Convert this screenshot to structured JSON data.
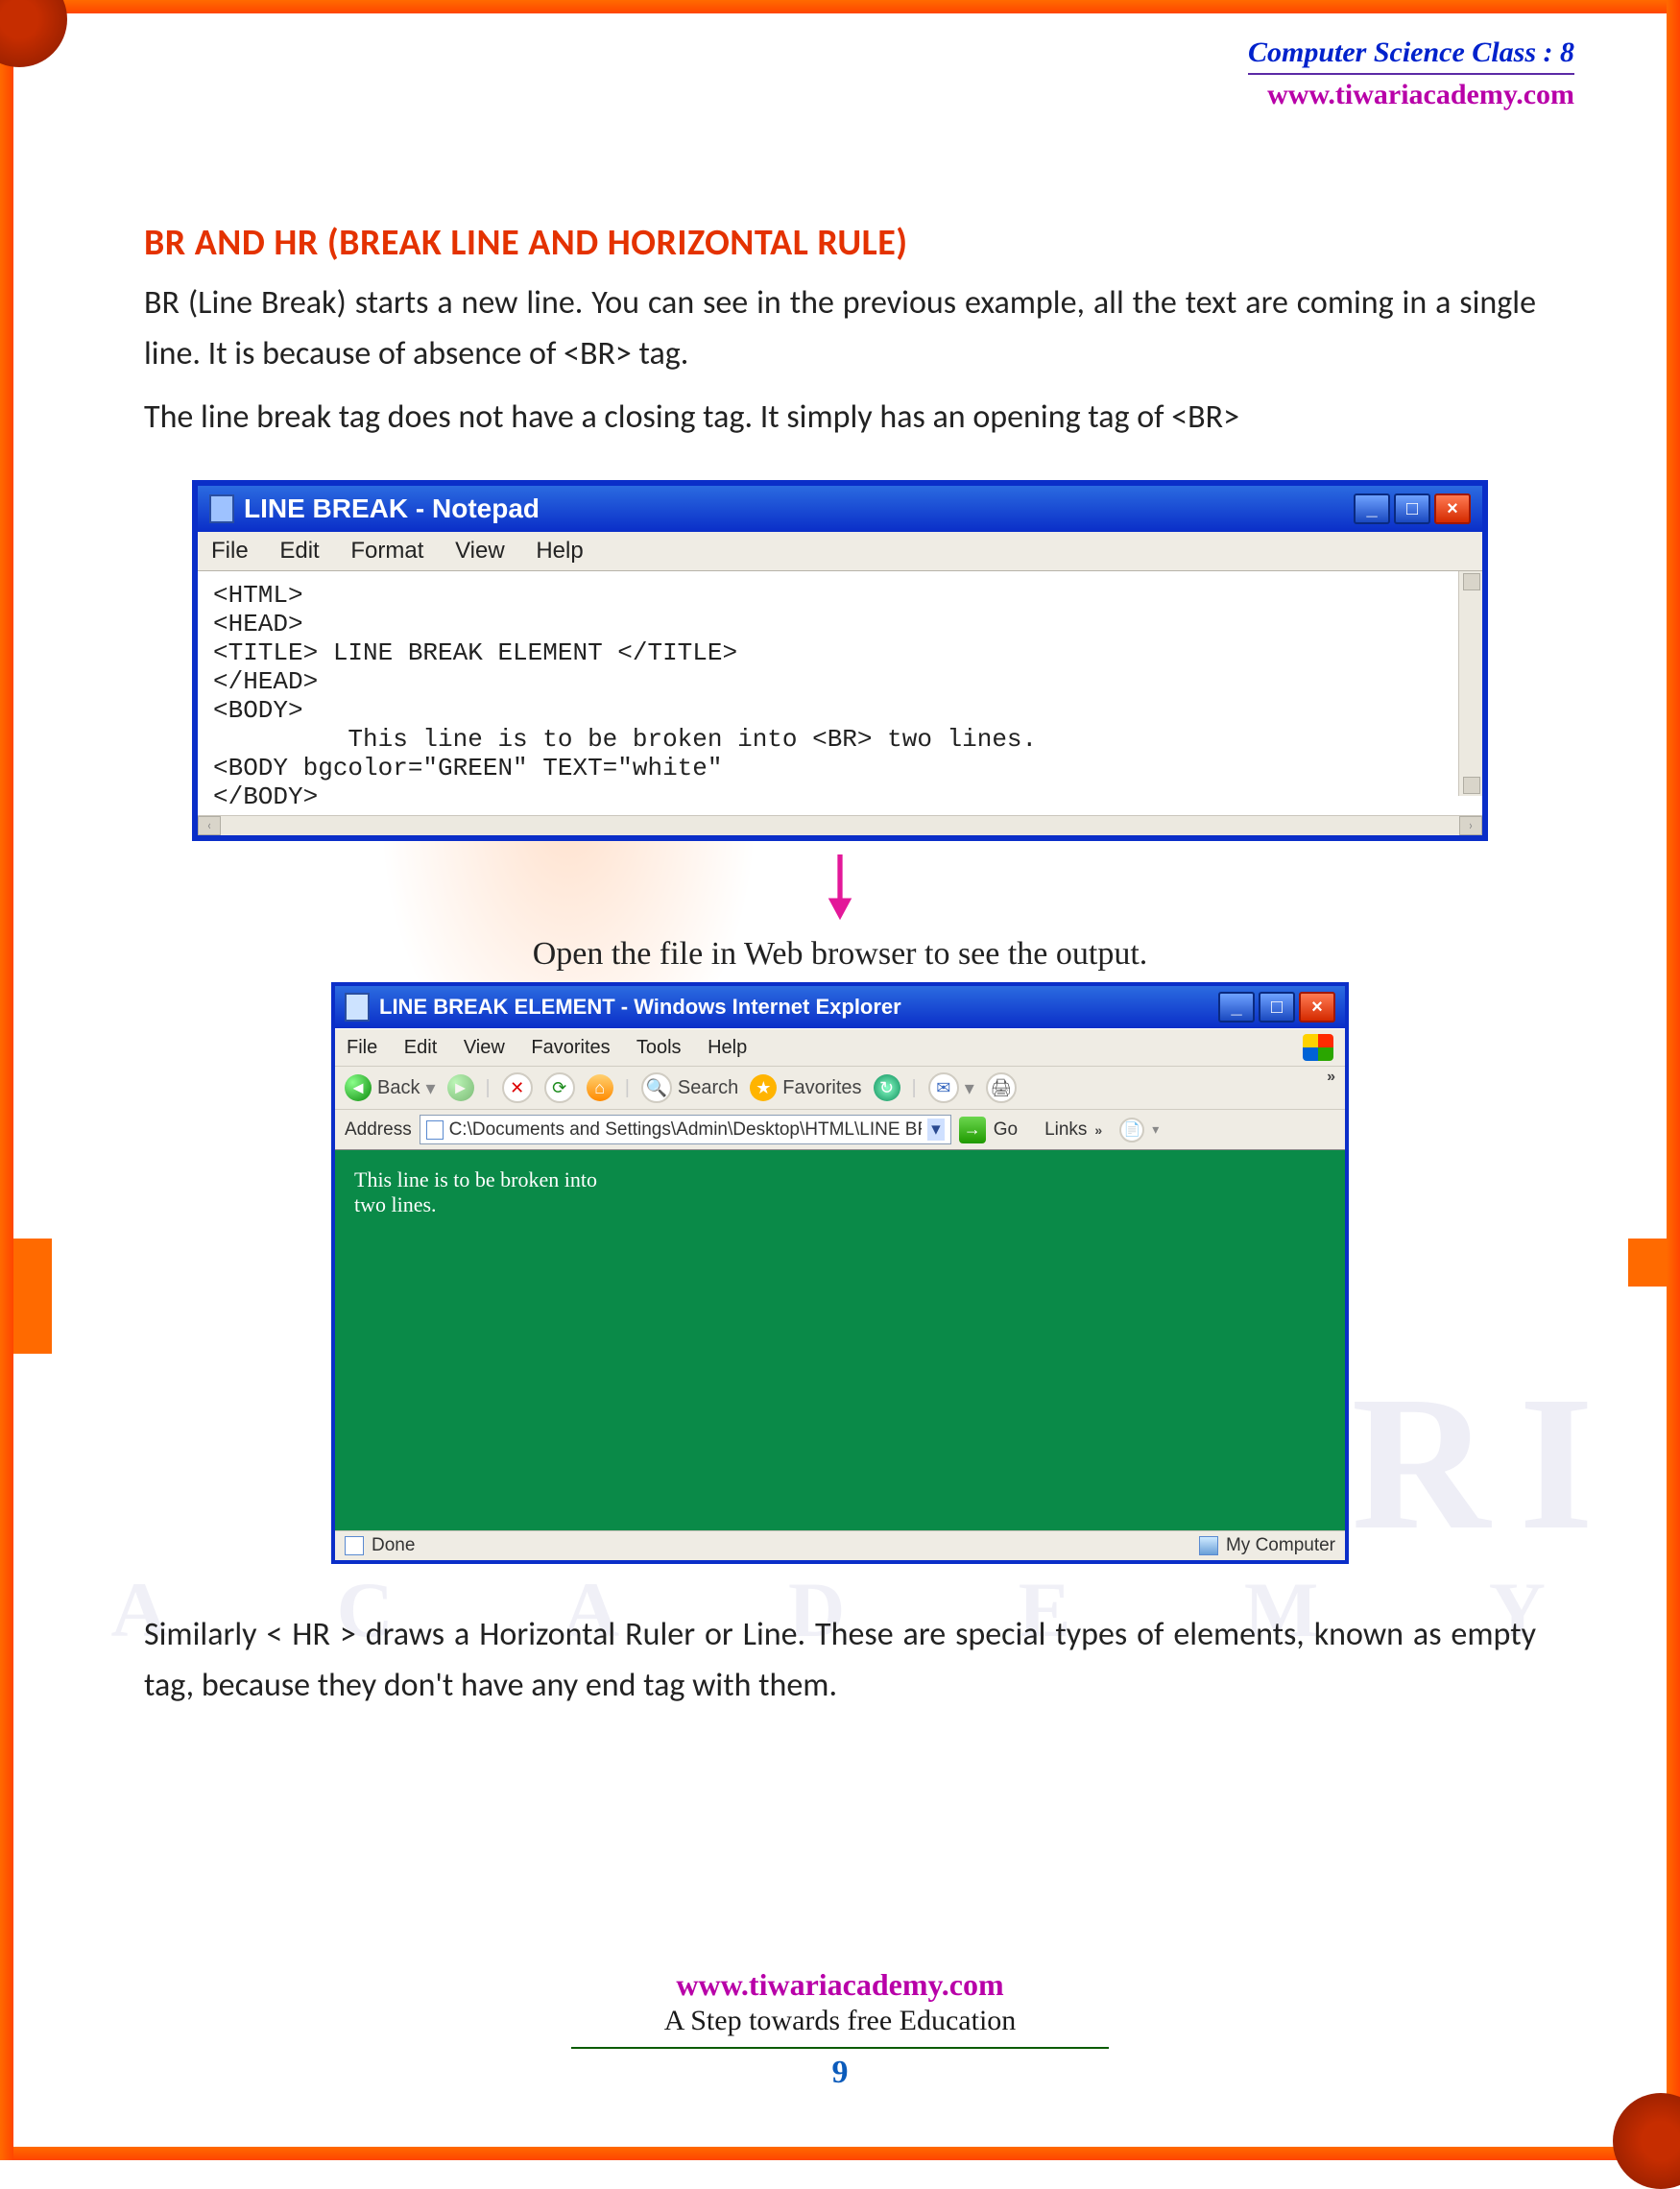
{
  "header": {
    "line1": "Computer Science Class : 8",
    "line2": "www.tiwariacademy.com"
  },
  "section_title": "BR AND HR (BREAK LINE AND HORIZONTAL RULE)",
  "para1": "BR (Line Break) starts a new line. You can see in the previous example, all the text are coming in a single line. It is because of absence of <BR> tag.",
  "para2": "The line break tag does not have a closing tag. It simply has an opening tag of <BR>",
  "notepad": {
    "title": "LINE BREAK - Notepad",
    "menu": [
      "File",
      "Edit",
      "Format",
      "View",
      "Help"
    ],
    "code_lines": [
      "<HTML>",
      "<HEAD>",
      "<TITLE> LINE BREAK ELEMENT </TITLE>",
      "</HEAD>",
      "<BODY>",
      "         This line is to be broken into <BR> two lines.",
      "<BODY bgcolor=\"GREEN\" TEXT=\"white\"",
      "</BODY>"
    ]
  },
  "caption": "Open the file in Web browser to see the output.",
  "ie": {
    "title": "LINE BREAK ELEMENT - Windows Internet Explorer",
    "menu": [
      "File",
      "Edit",
      "View",
      "Favorites",
      "Tools",
      "Help"
    ],
    "toolbar": {
      "back": "Back",
      "search": "Search",
      "favorites": "Favorites"
    },
    "address_label": "Address",
    "address_value": "C:\\Documents and Settings\\Admin\\Desktop\\HTML\\LINE BREAK.H",
    "go_label": "Go",
    "links_label": "Links",
    "output_line1": "This line is to be broken into",
    "output_line2": "two lines.",
    "status_left": "Done",
    "status_right": "My Computer"
  },
  "closing": "Similarly < HR > draws a Horizontal Ruler or Line. These are special types of elements, known as empty tag, because they don't have any end tag with them.",
  "footer": {
    "url": "www.tiwariacademy.com",
    "tag": "A Step towards free Education",
    "page": "9"
  }
}
